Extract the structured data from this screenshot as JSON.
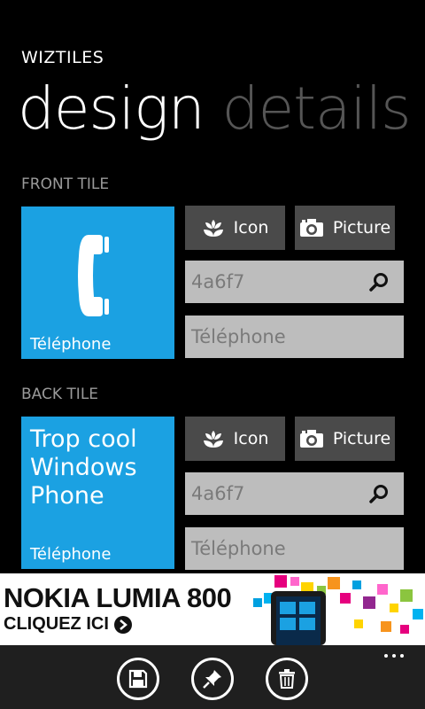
{
  "app": {
    "title": "WIZTILES"
  },
  "pivot": {
    "active": "design",
    "inactive": "details"
  },
  "front": {
    "section_label": "FRONT TILE",
    "tile_label": "Téléphone",
    "icon_button": "Icon",
    "picture_button": "Picture",
    "color_value": "4a6f7",
    "title_value": "Téléphone"
  },
  "back": {
    "section_label": "BACK TILE",
    "tile_message": "Trop cool Windows Phone",
    "tile_label": "Téléphone",
    "icon_button": "Icon",
    "picture_button": "Picture",
    "color_value": "4a6f7",
    "title_value": "Téléphone"
  },
  "ad": {
    "line1": "NOKIA LUMIA 800",
    "line2": "CLIQUEZ ICI"
  },
  "appbar": {
    "buttons": [
      "save-icon",
      "pin-icon",
      "delete-icon"
    ],
    "more": "ellipsis-icon"
  },
  "colors": {
    "accent": "#1ba1e2",
    "button": "#4a4a4a",
    "field": "#bdbdbd",
    "appbar": "#1f1f1f"
  }
}
